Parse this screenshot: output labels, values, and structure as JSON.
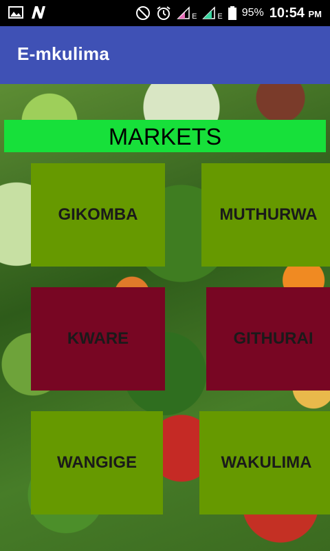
{
  "status_bar": {
    "battery": "95%",
    "time": "10:54",
    "ampm": "PM",
    "network_label_1": "E",
    "network_label_2": "E"
  },
  "app_bar": {
    "title": "E-mkulima"
  },
  "banner": {
    "label": "MARKETS"
  },
  "markets": [
    {
      "label": "GIKOMBA",
      "color": "#669900"
    },
    {
      "label": "MUTHURWA",
      "color": "#669900"
    },
    {
      "label": "KWARE",
      "color": "#780623"
    },
    {
      "label": "GITHURAI",
      "color": "#780623"
    },
    {
      "label": "WANGIGE",
      "color": "#669900"
    },
    {
      "label": "WAKULIMA",
      "color": "#669900"
    }
  ],
  "colors": {
    "app_bar": "#3f51b5",
    "banner": "#17e03a"
  }
}
